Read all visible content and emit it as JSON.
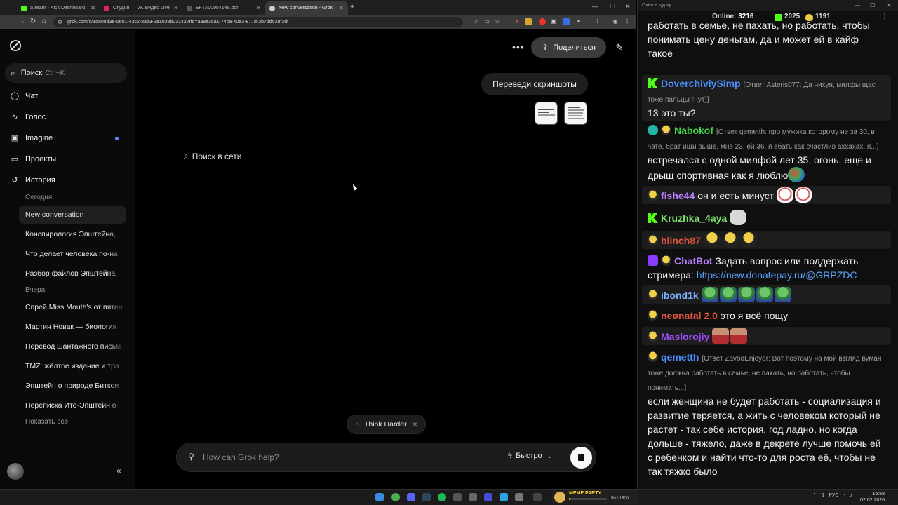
{
  "browser": {
    "tabs": [
      {
        "label": "Stream - Kick Dashboard",
        "favicon_color": "#53fc18",
        "active": false
      },
      {
        "label": "Студия — VK Видео Live",
        "favicon_color": "#e0245e",
        "active": false
      },
      {
        "label": "EFTA00954148.pdf",
        "favicon_color": "#5a5a5a",
        "active": false
      },
      {
        "label": "New conversation - Grok",
        "favicon_color": "#cfcfcf",
        "active": true
      }
    ],
    "url": "grok.com/c/1d808d3e-0601-43c2-8ad3-2a1038b03142?rid=a38e35a1-74ca-40a3-877d-3b7dd528f2df"
  },
  "sidebar": {
    "search_label": "Поиск",
    "search_shortcut": "Ctrl+K",
    "nav": [
      {
        "label": "Чат",
        "icon": "chat-bubble-icon"
      },
      {
        "label": "Голос",
        "icon": "waveform-icon"
      },
      {
        "label": "Imagine",
        "icon": "image-icon"
      },
      {
        "label": "Проекты",
        "icon": "folder-icon"
      },
      {
        "label": "История",
        "icon": "history-icon"
      }
    ],
    "history": {
      "today_label": "Сегодня",
      "today": [
        "New conversation",
        "Конспирология Эпштейна, ",
        "Что делает человека по-на",
        "Разбор файлов Эпштейна: "
      ],
      "yesterday_label": "Вчера",
      "yesterday": [
        "Спрей Miss Mouth's от пятен",
        "Мартин Новак — биология ",
        "Перевод шантажного письм",
        "TMZ: жёлтое издание и тра",
        "Эпштейн о природе Биткои",
        "Переписка Ито-Эпштейн о "
      ],
      "show_all": "Показать всё"
    }
  },
  "main": {
    "share_label": "Поделиться",
    "user_message": "Переведи скриншоты",
    "web_search": "Поиск в сети",
    "think_chip": "Think Harder",
    "composer_placeholder": "How can Grok help?",
    "mode_label": "Быстро"
  },
  "chat": {
    "window_title": "Окно в дурку",
    "online_label": "Online:",
    "online": "3216",
    "kick_count": "2025",
    "coin_count": "1191",
    "messages": [
      {
        "user": "",
        "color": "#f2f2f2",
        "text": "работать в семье, не пахать, но работать, чтобы понимать цену деньгам, да и может ей в кайф такое"
      },
      {
        "user": "DoverchiviySimp",
        "color": "#4a90ff",
        "badge": "kick",
        "reply": "[Ответ Asteris077: Да нихуя, милфы щас тоже пальцы гнут)]",
        "text": "13 это ты?"
      },
      {
        "user": "Nabokof",
        "color": "#3fd34a",
        "badge": "verified",
        "reply": "[Ответ qemetth: про мужика которому не за 30, в чате, брат ищи выше, мне 23, ей 36, я ебать как счастлив аххахах, я...]",
        "text": "встречался с одной милфой лет 35. огонь. еще и дрыщ спортивная как я люблю"
      },
      {
        "user": "fishe44",
        "color": "#b97cff",
        "badge": "pepe",
        "text": "он и есть минуст"
      },
      {
        "user": "Kruzhka_4aya",
        "color": "#7be06d",
        "badge": "kick",
        "text": ""
      },
      {
        "user": "blinch87",
        "color": "#e0553f",
        "badge": "pepe",
        "text": ""
      },
      {
        "user": "ChatBot",
        "color": "#b57cff",
        "badge": "bot",
        "text": "Задать вопрос или поддержать стримера:",
        "link": "https://new.donatepay.ru/@GRPZDC"
      },
      {
        "user": "ibond1k",
        "color": "#7ab0ff",
        "badge": "pepe",
        "text": ""
      },
      {
        "user": "neønatal 2.0",
        "color": "#e0553f",
        "badge": "pepe",
        "text": "это я всё пощу"
      },
      {
        "user": "Maslorojiy",
        "color": "#a44dff",
        "badge": "pepe",
        "text": ""
      },
      {
        "user": "qemetth",
        "color": "#4a90ff",
        "badge": "pepe",
        "reply": "[Ответ ZavodEnjoyer: Вот поэтому на мой взгляд вуман тоже должна работать в семье, не пахать, но работать, чтобы понимать...]",
        "text": "если женщина не будет работать - социализация и развитие теряется, а жить с человеком который не растет - так себе история, год ладно, но когда дольше - тяжело, даже в декрете лучше помочь ей с ребенком и найти что-то для роста её, чтобы не так тяжко было"
      }
    ]
  },
  "taskbar": {
    "widget_title": "MEME PARTY",
    "widget_count": "50 / 1500",
    "widget_progress": 0.033,
    "lang": "РУС",
    "time": "16:58",
    "date": "02.02.2026"
  }
}
